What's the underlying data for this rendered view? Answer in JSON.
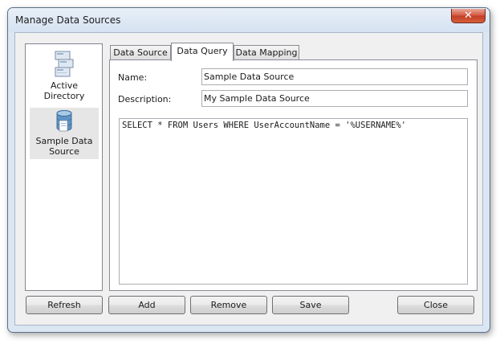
{
  "window": {
    "title": "Manage Data Sources",
    "close_glyph": "✕"
  },
  "sources": [
    {
      "label": "Active Directory",
      "icon": "active-directory-icon",
      "selected": false
    },
    {
      "label": "Sample Data Source",
      "icon": "database-icon",
      "selected": true
    }
  ],
  "tabs": [
    {
      "label": "Data Source",
      "active": false
    },
    {
      "label": "Data Query",
      "active": true
    },
    {
      "label": "Data Mapping",
      "active": false
    }
  ],
  "form": {
    "name_label": "Name:",
    "name_value": "Sample Data Source",
    "description_label": "Description:",
    "description_value": "My Sample Data Source",
    "query_value": "SELECT * FROM Users WHERE UserAccountName = '%USERNAME%'"
  },
  "buttons": {
    "refresh": "Refresh",
    "add": "Add",
    "remove": "Remove",
    "save": "Save",
    "close": "Close"
  },
  "colors": {
    "frame": "#dbe6f3",
    "close_red": "#c23c25",
    "selection": "#e6e6e6"
  }
}
